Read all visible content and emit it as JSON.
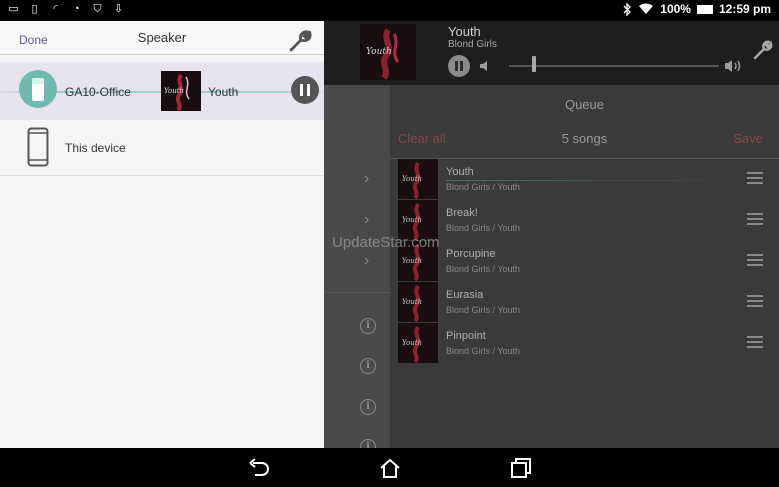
{
  "status_bar": {
    "battery": "100%",
    "time": "12:59 pm",
    "left_icons": [
      "sd-card-icon",
      "phone-icon",
      "wifi-signal-icon",
      "speedometer-icon",
      "shield-icon",
      "download-icon"
    ],
    "right_icons": [
      "bluetooth-icon",
      "wifi-icon",
      "battery-icon"
    ]
  },
  "speaker_panel": {
    "done_label": "Done",
    "title": "Speaker",
    "settings_icon": "wrench-icon",
    "devices": [
      {
        "name": "GA10-Office",
        "track": "Youth",
        "icon": "speaker-icon",
        "state": "playing"
      },
      {
        "name": "This device",
        "icon": "phone-icon"
      }
    ]
  },
  "player": {
    "title": "Youth",
    "artist": "Blond Girls",
    "volume_level": 0.12
  },
  "queue": {
    "title": "Queue",
    "clear_label": "Clear all",
    "count_label": "5 songs",
    "save_label": "Save",
    "songs": [
      {
        "title": "Youth",
        "subtitle": "Blond Girls / Youth"
      },
      {
        "title": "Break!",
        "subtitle": "Blond Girls / Youth"
      },
      {
        "title": "Porcupine",
        "subtitle": "Blond Girls / Youth"
      },
      {
        "title": "Eurasia",
        "subtitle": "Blond Girls / Youth"
      },
      {
        "title": "Pinpoint",
        "subtitle": "Blond Girls / Youth"
      }
    ]
  },
  "watermark": "UpdateStar.com",
  "colors": {
    "accent_teal": "#6fb9b0",
    "done_link": "#5a5aa0",
    "queue_action_red": "#8a4848"
  }
}
